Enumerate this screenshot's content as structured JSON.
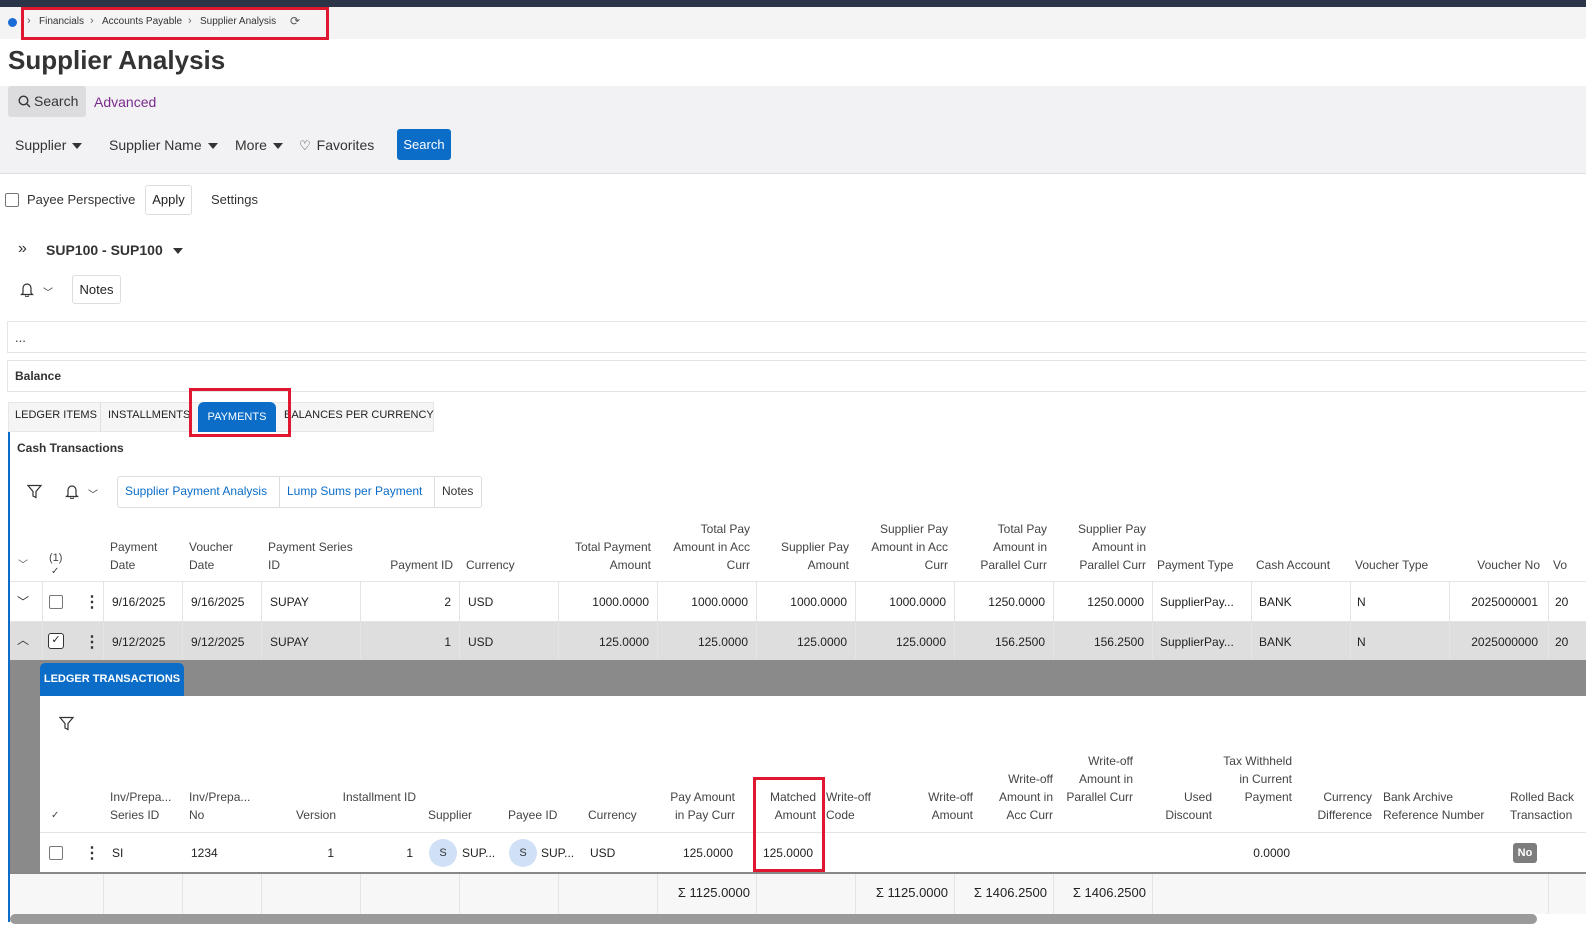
{
  "breadcrumb": {
    "items": [
      "Financials",
      "Accounts Payable",
      "Supplier Analysis"
    ]
  },
  "page": {
    "title": "Supplier Analysis"
  },
  "search": {
    "search_tab": "Search",
    "advanced_tab": "Advanced",
    "filters": [
      "Supplier",
      "Supplier Name",
      "More"
    ],
    "favorites": "Favorites",
    "search_button": "Search"
  },
  "options": {
    "payee_perspective": "Payee Perspective",
    "apply": "Apply",
    "settings": "Settings"
  },
  "record": {
    "selector": "SUP100 - SUP100",
    "notes": "Notes",
    "ellipsis": "...",
    "balance": "Balance"
  },
  "tabs": [
    "LEDGER ITEMS",
    "INSTALLMENTS",
    "PAYMENTS",
    "BALANCES PER CURRENCY"
  ],
  "cash": {
    "title": "Cash Transactions",
    "toolbar": [
      "Supplier Payment Analysis",
      "Lump Sums per Payment",
      "Notes"
    ],
    "selected_count": "(1)",
    "columns": [
      "Payment Date",
      "Voucher Date",
      "Payment Series ID",
      "Payment ID",
      "Currency",
      "Total Payment Amount",
      "Total Pay Amount in Acc Curr",
      "Supplier Pay Amount",
      "Supplier Pay Amount in Acc Curr",
      "Total Pay Amount in Parallel Curr",
      "Supplier Pay Amount in Parallel Curr",
      "Payment Type",
      "Cash Account",
      "Voucher Type",
      "Voucher No",
      "Vo"
    ],
    "rows": [
      [
        "9/16/2025",
        "9/16/2025",
        "SUPAY",
        "2",
        "USD",
        "1000.0000",
        "1000.0000",
        "1000.0000",
        "1000.0000",
        "1250.0000",
        "1250.0000",
        "SupplierPay...",
        "BANK",
        "N",
        "2025000001",
        "20"
      ],
      [
        "9/12/2025",
        "9/12/2025",
        "SUPAY",
        "1",
        "USD",
        "125.0000",
        "125.0000",
        "125.0000",
        "125.0000",
        "156.2500",
        "156.2500",
        "SupplierPay...",
        "BANK",
        "N",
        "2025000000",
        "20"
      ]
    ],
    "totals": [
      "Σ 1125.0000",
      "Σ 1125.0000",
      "Σ 1406.2500",
      "Σ 1406.2500"
    ]
  },
  "ledger": {
    "tab": "LEDGER TRANSACTIONS",
    "columns": [
      "Inv/Prepa... Series ID",
      "Inv/Prepa... No",
      "Version",
      "Installment ID",
      "Supplier",
      "Payee ID",
      "Currency",
      "Pay Amount in Pay Curr",
      "Matched Amount",
      "Write-off Code",
      "Write-off Amount",
      "Write-off Amount in Acc Curr",
      "Write-off Amount in Parallel Curr",
      "Used Discount",
      "Tax Withheld in Current Payment",
      "Currency Difference",
      "Bank Archive Reference Number",
      "Rolled Back Transaction"
    ],
    "row": {
      "series": "SI",
      "no": "1234",
      "version": "1",
      "installment": "1",
      "supplier_initial": "S",
      "supplier": "SUP...",
      "payee_initial": "S",
      "payee": "SUP...",
      "currency": "USD",
      "pay_amount": "125.0000",
      "matched": "125.0000",
      "tax": "0.0000",
      "rolled_back": "No"
    }
  },
  "colors": {
    "accent": "#0b6dc8",
    "highlight": "#e0182f",
    "topbar": "#2b3547"
  }
}
